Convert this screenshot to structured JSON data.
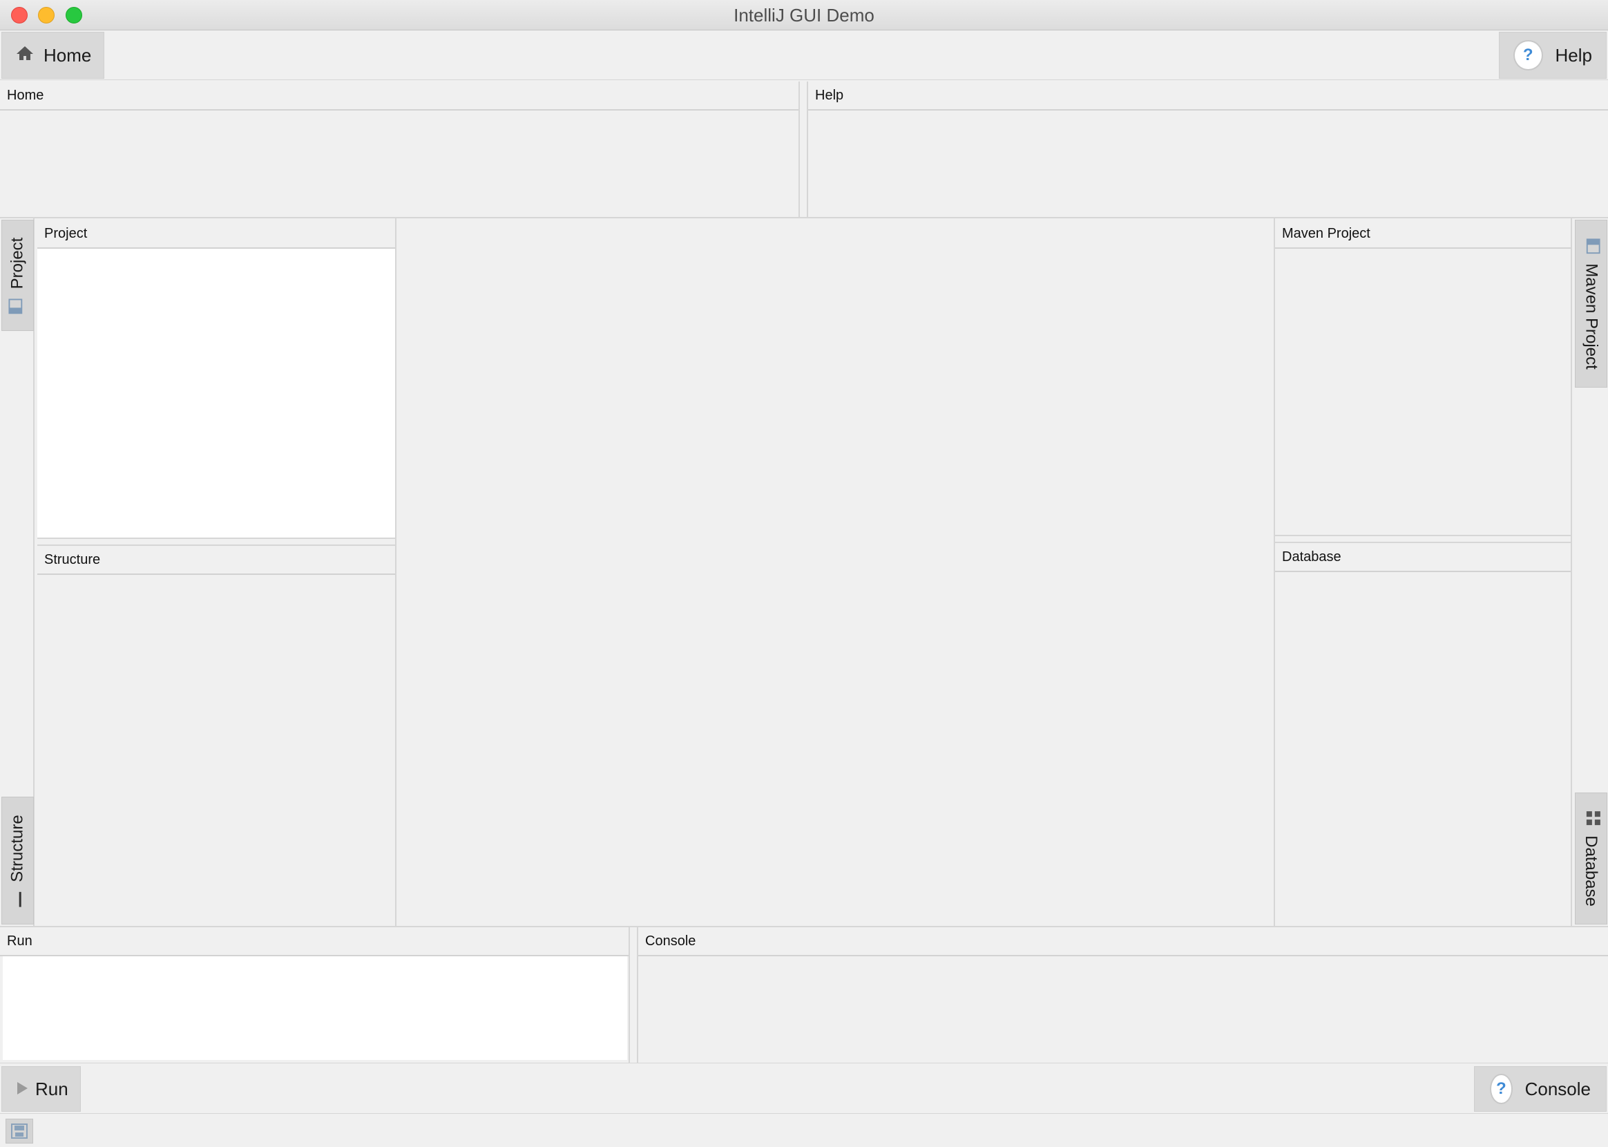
{
  "window": {
    "title": "IntelliJ GUI Demo",
    "buttons": [
      "close",
      "minimize",
      "maximize"
    ]
  },
  "top_toolbar": {
    "home_label": "Home",
    "home_icon": "home-icon",
    "help_label": "Help",
    "help_icon": "help-icon"
  },
  "top_panels": {
    "home_title": "Home",
    "help_title": "Help"
  },
  "left_panels": {
    "project_title": "Project",
    "structure_title": "Structure"
  },
  "right_panels": {
    "maven_title": "Maven Project",
    "database_title": "Database"
  },
  "left_tabs": {
    "project": "Project",
    "structure": "Structure"
  },
  "right_tabs": {
    "maven": "Maven Project",
    "database": "Database"
  },
  "bottom_panels": {
    "run_title": "Run",
    "console_title": "Console"
  },
  "bottom_toolbar": {
    "run_label": "Run",
    "run_icon": "play-icon",
    "console_label": "Console",
    "console_icon": "help-icon"
  },
  "status_bar": {
    "icon": "save-icon"
  }
}
